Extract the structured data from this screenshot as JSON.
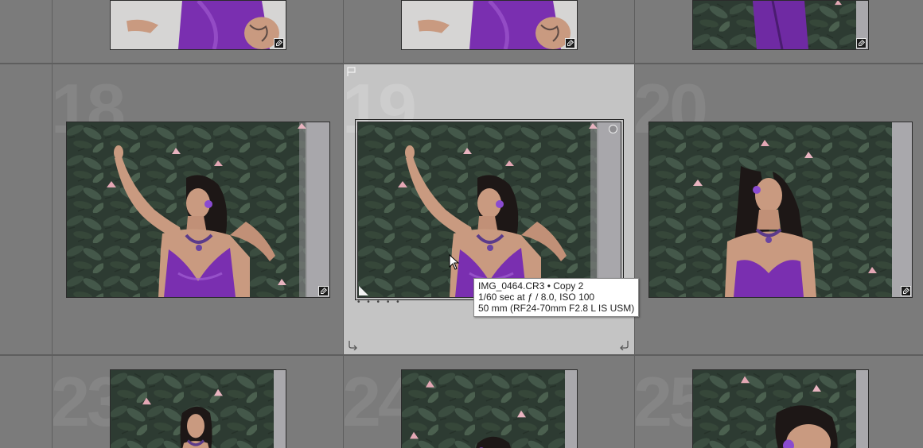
{
  "grid": {
    "cells": [
      {
        "index": "18"
      },
      {
        "index": "19"
      },
      {
        "index": "20"
      },
      {
        "index": "23"
      },
      {
        "index": "24"
      },
      {
        "index": "25"
      }
    ]
  },
  "selected_cell": "19",
  "rating_dots": "• • • • •",
  "tooltip": {
    "line1": "IMG_0464.CR3  •  Copy 2",
    "line2": "1/60 sec at ƒ / 8.0, ISO 100",
    "line3": "50 mm (RF24-70mm F2.8 L IS USM)"
  },
  "colors": {
    "cell_bg": "#7b7b7b",
    "selected_bg": "#c4c4c4",
    "gutter": "#5e5e5e",
    "foliage": "#2f3f35",
    "dress": "#7a2fb0"
  },
  "icons": [
    "edit-badge-icon",
    "flag-icon",
    "circle-icon",
    "rotate-left-icon",
    "rotate-right-icon",
    "cursor-icon"
  ]
}
